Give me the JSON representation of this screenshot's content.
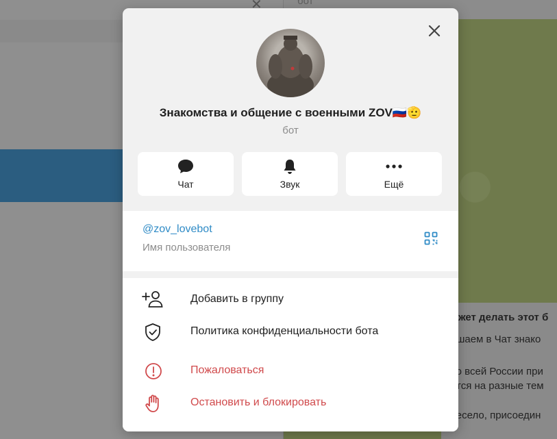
{
  "background": {
    "chat_status": "бот",
    "message_lines": [
      "ожет делать этот б",
      "ашаем в Чат знако",
      "со всей России при",
      "отся на разные тем",
      "весело, присоедин"
    ]
  },
  "profile": {
    "name": "Знакомства и общение с военными ZOV🇷🇺🫡",
    "subtitle": "бот",
    "avatar": "avatar-image"
  },
  "actions": [
    {
      "label": "Чат",
      "icon": "chat-bubble-icon"
    },
    {
      "label": "Звук",
      "icon": "bell-icon"
    },
    {
      "label": "Ещё",
      "icon": "more-dots-icon"
    }
  ],
  "info": {
    "username": "@zov_lovebot",
    "username_label": "Имя пользователя"
  },
  "menu": [
    {
      "label": "Добавить в группу",
      "icon": "add-user-icon",
      "danger": false
    },
    {
      "label": "Политика конфиденциальности бота",
      "icon": "shield-check-icon",
      "danger": false
    },
    {
      "label": "Пожаловаться",
      "icon": "report-icon",
      "danger": true
    },
    {
      "label": "Остановить и блокировать",
      "icon": "stop-hand-icon",
      "danger": true
    }
  ],
  "colors": {
    "link": "#2f8bc6",
    "danger": "#d0494b",
    "overlay": "#8f8f8f"
  }
}
